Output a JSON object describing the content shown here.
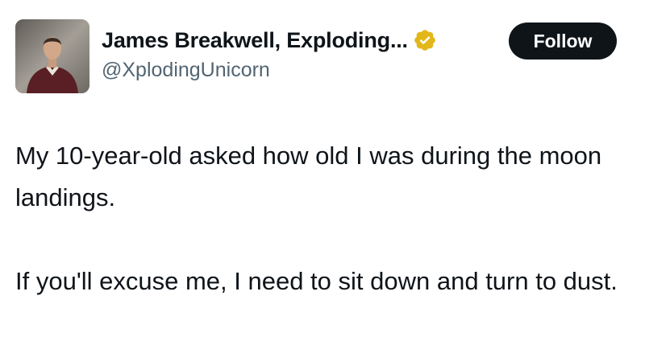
{
  "author": {
    "display_name": "James Breakwell, Exploding...",
    "handle": "@XplodingUnicorn",
    "avatar_icon": "profile-photo",
    "verified_badge_icon": "verified-badge-icon",
    "verified_badge_color": "#E2B719"
  },
  "actions": {
    "follow_label": "Follow"
  },
  "tweet": {
    "paragraphs": [
      "My 10-year-old asked how old I was during the moon landings.",
      "If you'll excuse me, I need to sit down and turn to dust."
    ]
  },
  "colors": {
    "text_primary": "#0F1419",
    "text_secondary": "#536471",
    "follow_button_bg": "#0F1419",
    "follow_button_text": "#FFFFFF",
    "background": "#FFFFFF"
  }
}
